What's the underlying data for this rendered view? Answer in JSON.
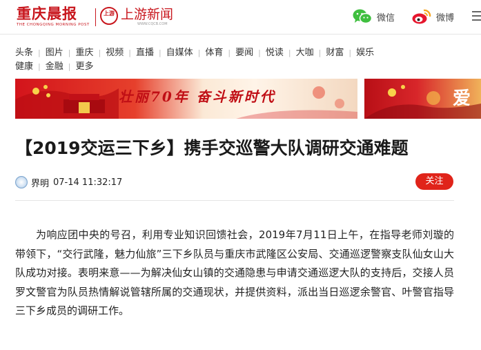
{
  "header": {
    "brand_cn": "重庆晨报",
    "brand_en": "THE CHONGQING MORNING POST",
    "sy_logo_text": "上游",
    "sy_name": "上游新闻",
    "sy_url": "WWW.CQCB.COM",
    "share_wechat": "微信",
    "share_weibo": "微博",
    "brand_color": "#c8161d"
  },
  "nav": {
    "row1": [
      "头条",
      "图片",
      "重庆",
      "视频",
      "直播",
      "自媒体",
      "体育",
      "要闻",
      "悦读",
      "大咖",
      "财富",
      "娱乐"
    ],
    "row2": [
      "健康",
      "金融",
      "更多"
    ]
  },
  "banners": {
    "slogan": "壮丽70年 奋斗新时代",
    "banner2_text": "爱"
  },
  "article": {
    "title": "【2019交运三下乡】携手交巡警大队调研交通难题",
    "author": "界明",
    "time": "07-14 11:32:17",
    "follow_label": "关注",
    "follow_color": "#e0241a",
    "paragraph": "为响应团中央的号召，利用专业知识回馈社会，2019年7月11日上午，在指导老师刘璇的带领下，“交行武隆，魅力仙旅”三下乡队员与重庆市武隆区公安局、交通巡逻警察支队仙女山大队成功对接。表明来意——为解决仙女山镇的交通隐患与申请交通巡逻大队的支持后，交接人员罗文警官为队员热情解说管辖所属的交通现状，并提供资料，派出当日巡逻余警官、叶警官指导三下乡成员的调研工作。"
  },
  "icons": {
    "wechat": "wechat-icon",
    "weibo": "weibo-icon",
    "menu": "menu-icon",
    "avatar": "author-avatar"
  }
}
